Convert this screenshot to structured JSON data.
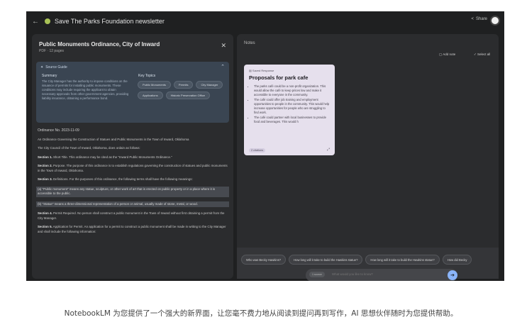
{
  "topbar": {
    "title": "Save The Parks Foundation newsletter",
    "share_label": "Share"
  },
  "source": {
    "title": "Public Monuments Ordinance, City of Inward",
    "meta": "PDF · 12 pages",
    "guide": {
      "header": "Source Guide",
      "summary_label": "Summary",
      "summary_text": "The City Manager has the authority to impose conditions on the issuance of permits for installing public monuments. These conditions may include requiring the applicant to obtain necessary approvals from other government agencies, providing liability insurance, obtaining a performance bond.",
      "topics_label": "Key Topics",
      "topics": [
        "Public Monuments",
        "Permits",
        "City Manager",
        "Applications",
        "Historic Preservation Office"
      ]
    },
    "paragraphs": [
      {
        "lead": "",
        "text": "Ordinance No. 2023-11-09"
      },
      {
        "lead": "",
        "text": "An Ordinance Governing the Construction of Statues and Public Monuments in the Town of Inward, Oklahoma"
      },
      {
        "lead": "",
        "text": "The City Council of the Town of Inward, Oklahoma, does ordain as follows:"
      },
      {
        "lead": "Section 1.",
        "text": " Short Title. This ordinance may be cited as the \"Inward Public Monuments Ordinance.\""
      },
      {
        "lead": "Section 2.",
        "text": " Purpose. The purpose of this ordinance is to establish regulations governing the construction of statues and public monuments in the Town of Inward, Oklahoma."
      },
      {
        "lead": "Section 3.",
        "text": " Definitions. For the purposes of this ordinance, the following terms shall have the following meanings:"
      },
      {
        "lead": "",
        "text": "(a) \"Public monument\" means any statue, sculpture, or other work of art that is erected on public property or in a place where it is accessible to the public."
      },
      {
        "lead": "",
        "text": "(b) \"Statue\" means a three-dimensional representation of a person or animal, usually made of stone, metal, or wood."
      },
      {
        "lead": "Section 4.",
        "text": " Permit Required. No person shall construct a public monument in the Town of Inward without first obtaining a permit from the City Manager."
      },
      {
        "lead": "Section 5.",
        "text": " Application for Permit. An application for a permit to construct a public monument shall be made in writing to the City Manager and shall include the following information:"
      }
    ]
  },
  "notes": {
    "label": "Notes",
    "add_note_label": "Add note",
    "select_all_label": "Select all",
    "card": {
      "tag": "Saved Response",
      "title": "Proposals for park cafe",
      "bullets": [
        "The parks café could be a non-profit organization. This would allow the café to keep prices low and make it accessible to everyone in the community.",
        "The café could offer job training and employment opportunities to people in the community. This would help increase opportunities for people who are struggling to find work.",
        "The café could partner with local businesses to provide food and beverages. This would h"
      ],
      "footer": "2 citations"
    }
  },
  "chat": {
    "suggestions": [
      "Who was Becky Hawkins?",
      "How long will it take to build the Hawkins statue?",
      "How long will it take to build the Hawkins statue?",
      "How did Becky"
    ],
    "source_count": "1 source",
    "placeholder": "What would you like to know?"
  },
  "caption": "NotebookLM 为您提供了一个强大的新界面，让您毫不费力地从阅读到提问再到写作，AI 思想伙伴随时为您提供帮助。",
  "colors": {
    "app_bg": "#1f2021",
    "panel_bg": "#2b2c2e",
    "guide_bg": "#3a4552",
    "note_bg": "#e6e0ed",
    "accent": "#8ab4f8",
    "brand_dot": "#a8c256"
  }
}
